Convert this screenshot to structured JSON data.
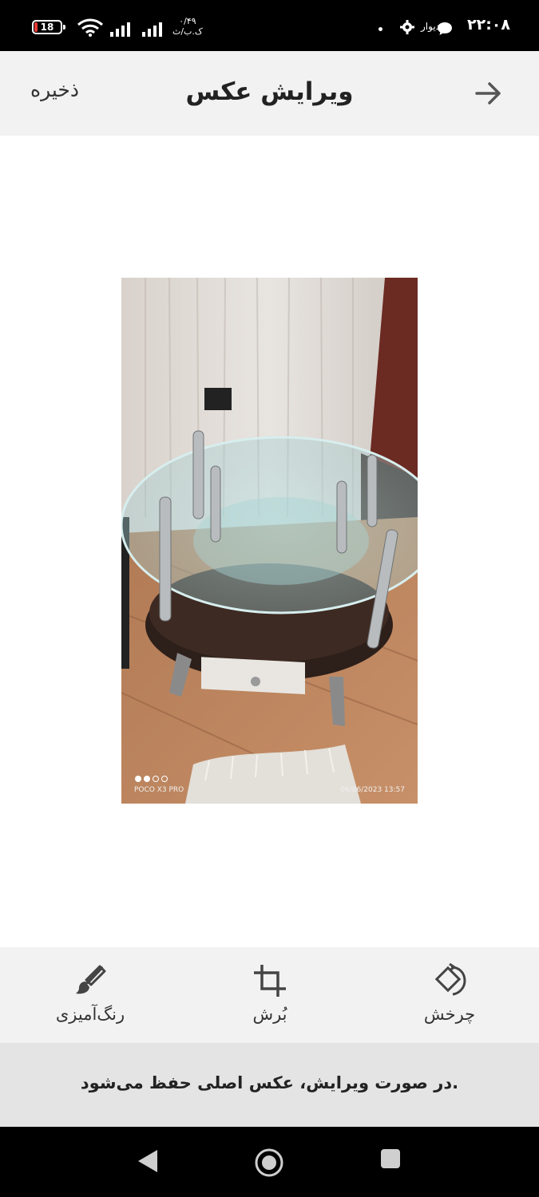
{
  "status_bar": {
    "time": "۲۲:۰۸",
    "app_label": "دیوار",
    "battery": "18",
    "speed_value": "۰/۴۹",
    "speed_unit": "ک.ب/ث"
  },
  "header": {
    "title": "ویرایش عکس",
    "save_label": "ذخیره"
  },
  "photo": {
    "device_caption": "POCO X3 PRO",
    "timestamp_caption": "06/06/2023  13:57"
  },
  "toolbar": {
    "colorize_label": "رنگ‌آمیزی",
    "crop_label": "بُرش",
    "rotate_label": "چرخش"
  },
  "notice": {
    "text": "در صورت ویرایش، عکس اصلی حفظ می‌شود."
  },
  "colors": {
    "status_bar_bg": "#000000",
    "header_bg": "#f2f2f2",
    "toolbar_bg": "#f2f2f2",
    "notice_bg": "#e4e4e4",
    "battery_low": "#e53935"
  }
}
